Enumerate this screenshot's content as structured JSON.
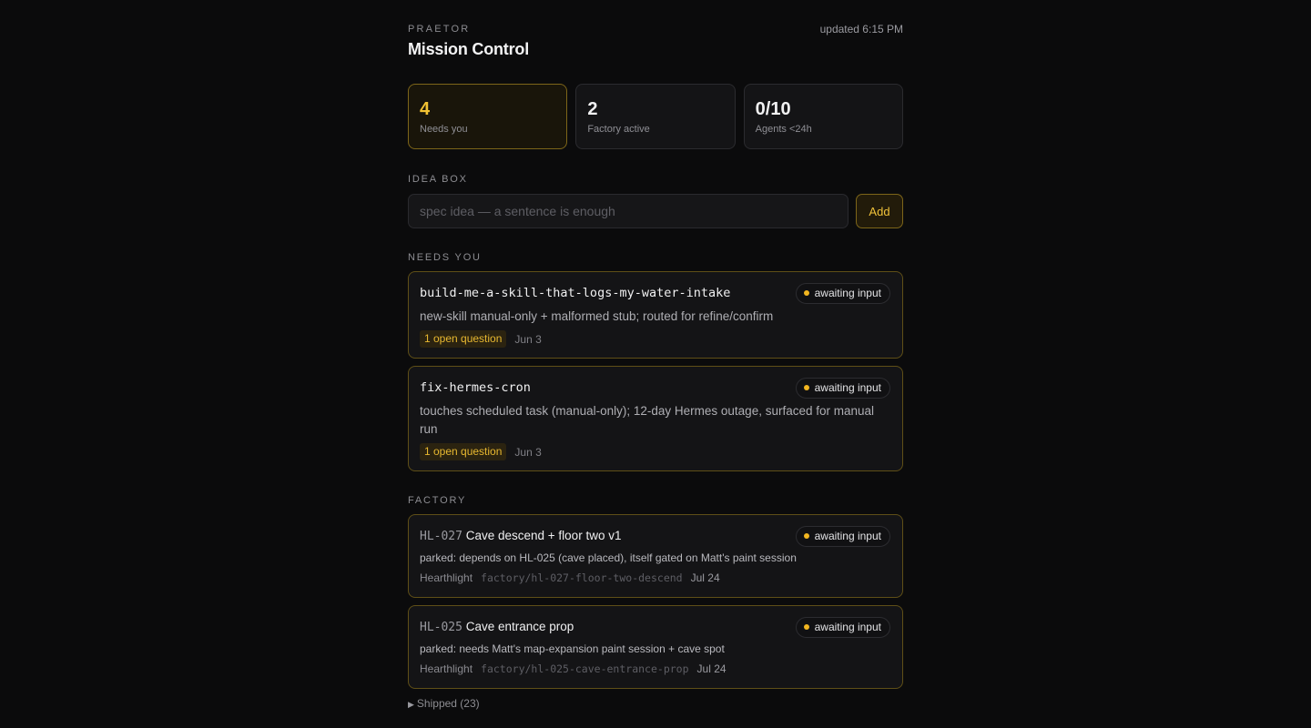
{
  "header": {
    "brand": "PRAETOR",
    "title": "Mission Control",
    "updated": "updated 6:15 PM"
  },
  "stats": [
    {
      "value": "4",
      "label": "Needs you"
    },
    {
      "value": "2",
      "label": "Factory active"
    },
    {
      "value": "0/10",
      "label": "Agents <24h"
    }
  ],
  "idea_box": {
    "label": "IDEA BOX",
    "placeholder": "spec idea — a sentence is enough",
    "value": "",
    "button": "Add"
  },
  "needs_you": {
    "label": "NEEDS YOU",
    "items": [
      {
        "title": "build-me-a-skill-that-logs-my-water-intake",
        "status": "awaiting input",
        "description": "new-skill manual-only + malformed stub; routed for refine/confirm",
        "questions": "1 open question",
        "date": "Jun 3"
      },
      {
        "title": "fix-hermes-cron",
        "status": "awaiting input",
        "description": "touches scheduled task (manual-only); 12-day Hermes outage, surfaced for manual run",
        "questions": "1 open question",
        "date": "Jun 3"
      }
    ]
  },
  "factory": {
    "label": "FACTORY",
    "items": [
      {
        "id": "HL-027",
        "title": "Cave descend + floor two v1",
        "status": "awaiting input",
        "description": "parked: depends on HL-025 (cave placed), itself gated on Matt's paint session",
        "project": "Hearthlight",
        "branch": "factory/hl-027-floor-two-descend",
        "date": "Jul 24"
      },
      {
        "id": "HL-025",
        "title": "Cave entrance prop",
        "status": "awaiting input",
        "description": "parked: needs Matt's map-expansion paint session + cave spot",
        "project": "Hearthlight",
        "branch": "factory/hl-025-cave-entrance-prop",
        "date": "Jul 24"
      }
    ]
  },
  "shipped": {
    "label": "Shipped (23)"
  },
  "colors": {
    "background": "#0b0b0c",
    "accent": "#f2c233",
    "status_dot": "#f2b620",
    "card_border": "#5f4f17"
  },
  "icons": {
    "status": "dot-icon",
    "shipped_toggle": "triangle-right-icon"
  }
}
